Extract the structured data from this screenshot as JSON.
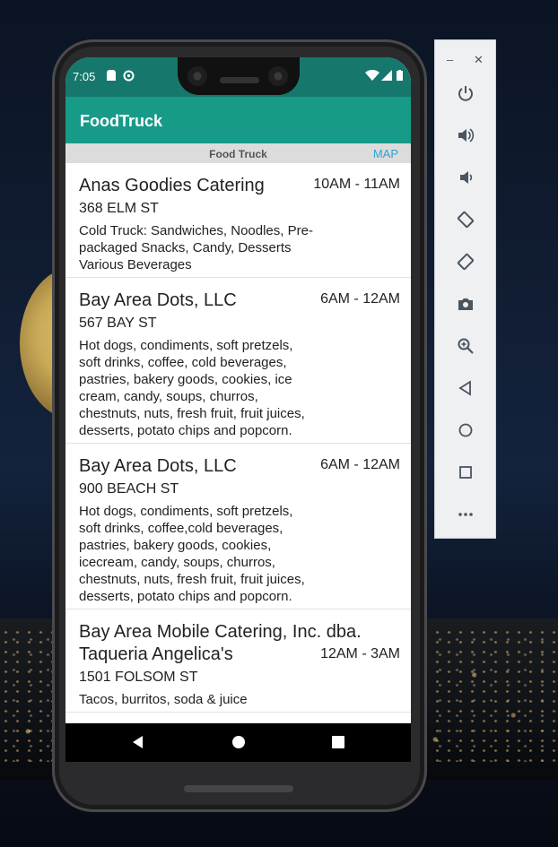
{
  "status_bar": {
    "time": "7:05"
  },
  "app": {
    "title": "FoodTruck"
  },
  "sub_header": {
    "label": "Food Truck",
    "map_label": "MAP"
  },
  "trucks": [
    {
      "name": "Anas Goodies Catering",
      "address": "368 ELM ST",
      "hours": "10AM - 11AM",
      "description": "Cold Truck: Sandwiches, Noodles, Pre-packaged Snacks, Candy, Desserts Various Beverages"
    },
    {
      "name": "Bay Area Dots, LLC",
      "address": "567 BAY ST",
      "hours": "6AM - 12AM",
      "description": "Hot dogs, condiments, soft pretzels, soft drinks, coffee, cold beverages, pastries, bakery goods, cookies, ice cream, candy, soups, churros, chestnuts, nuts, fresh fruit, fruit juices, desserts, potato chips and popcorn."
    },
    {
      "name": "Bay Area Dots, LLC",
      "address": "900 BEACH ST",
      "hours": "6AM - 12AM",
      "description": "Hot dogs, condiments, soft pretzels, soft drinks, coffee,cold beverages, pastries, bakery goods, cookies, icecream, candy, soups, churros, chestnuts, nuts, fresh fruit, fruit juices, desserts, potato chips and popcorn."
    },
    {
      "name": "Bay Area Mobile Catering, Inc. dba. Taqueria Angelica's",
      "address": "1501 FOLSOM ST",
      "hours": "12AM - 3AM",
      "description": "Tacos, burritos, soda & juice"
    }
  ],
  "nav_bar": {
    "buttons": [
      "back-icon",
      "home-icon",
      "overview-icon"
    ]
  },
  "emulator_toolbar": {
    "buttons": [
      "power-icon",
      "volume-up-icon",
      "volume-down-icon",
      "rotate-left-icon",
      "rotate-right-icon",
      "camera-icon",
      "zoom-icon",
      "back-icon",
      "home-icon",
      "overview-icon",
      "more-icon"
    ]
  },
  "colors": {
    "status_bar": "#16786c",
    "app_bar": "#189a89",
    "map_link": "#2aa4d8"
  }
}
